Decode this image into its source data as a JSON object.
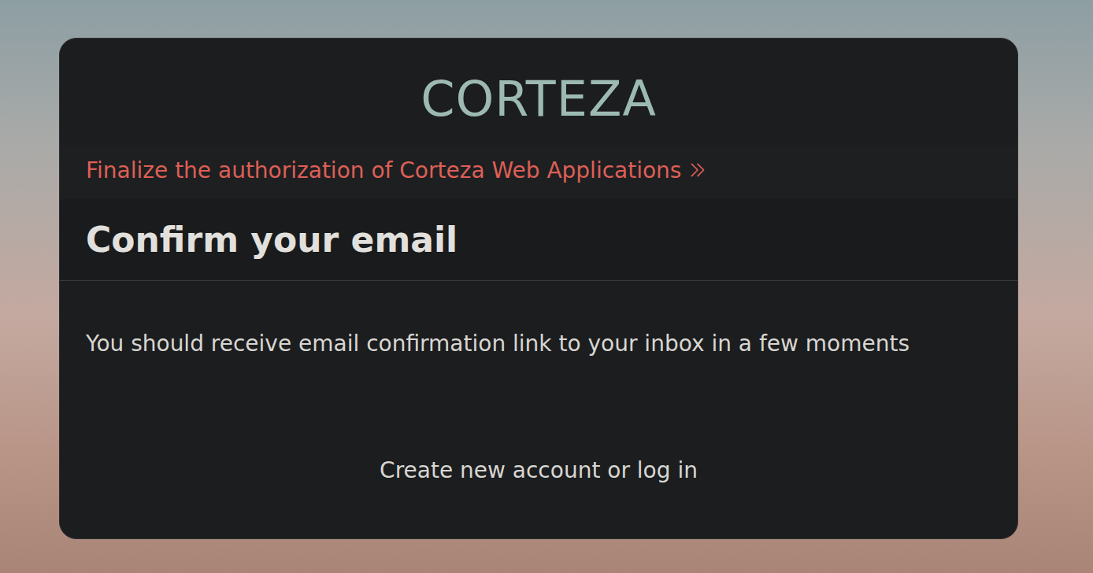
{
  "logo": "CORTEZA",
  "client_notice": "Finalize the authorization of Corteza Web Applications",
  "title": "Confirm your email",
  "message": "You should receive email confirmation link to your inbox in a few moments",
  "footer_link": "Create new account or log in"
}
